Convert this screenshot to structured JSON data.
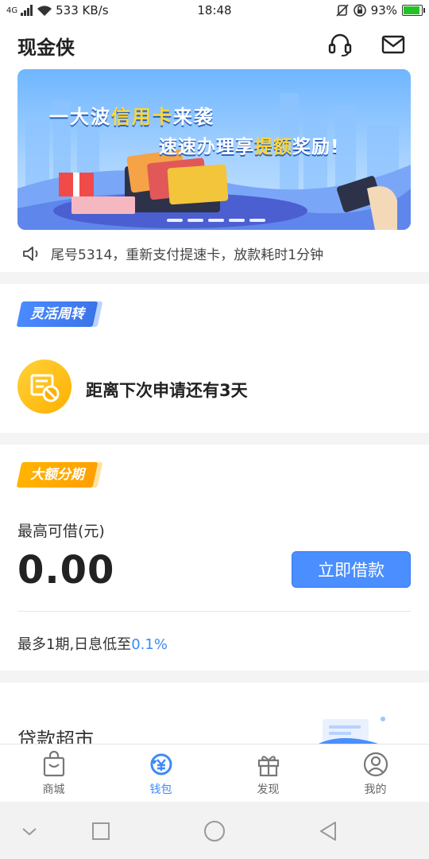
{
  "status_bar": {
    "network": "4G",
    "speed": "533 KB/s",
    "time": "18:48",
    "battery": "93%",
    "battery_level": 0.93,
    "battery_color": "#25c225"
  },
  "header": {
    "title": "现金侠",
    "icons": [
      "headset-icon",
      "mail-icon"
    ]
  },
  "banner": {
    "line1_prefix": "一大波",
    "line1_highlight": "信用卡",
    "line1_suffix": "来袭",
    "line2_prefix": "速速办理享",
    "line2_highlight": "提额",
    "line2_suffix": "奖励!",
    "slide_count": 5
  },
  "notice": {
    "icon": "speaker-icon",
    "text": "尾号5314，重新支付提速卡，放款耗时1分钟"
  },
  "flexible": {
    "tag": "灵活周转",
    "message": "距离下次申请还有3天"
  },
  "installment": {
    "tag": "大额分期",
    "max_label": "最高可借(元)",
    "amount": "0.00",
    "button": "立即借款",
    "rate_prefix": "最多1期,日息低至",
    "rate_value": "0.1%"
  },
  "market": {
    "title": "贷款超市"
  },
  "tabbar": [
    {
      "label": "商城",
      "icon": "bag-icon",
      "active": false
    },
    {
      "label": "钱包",
      "icon": "wallet-yen-icon",
      "active": true
    },
    {
      "label": "发现",
      "icon": "gift-icon",
      "active": false
    },
    {
      "label": "我的",
      "icon": "profile-icon",
      "active": false
    }
  ],
  "colors": {
    "accent": "#3d8af7",
    "button": "#4a8eff",
    "tag_blue": "#3b74e8",
    "tag_orange": "#ffa000"
  }
}
